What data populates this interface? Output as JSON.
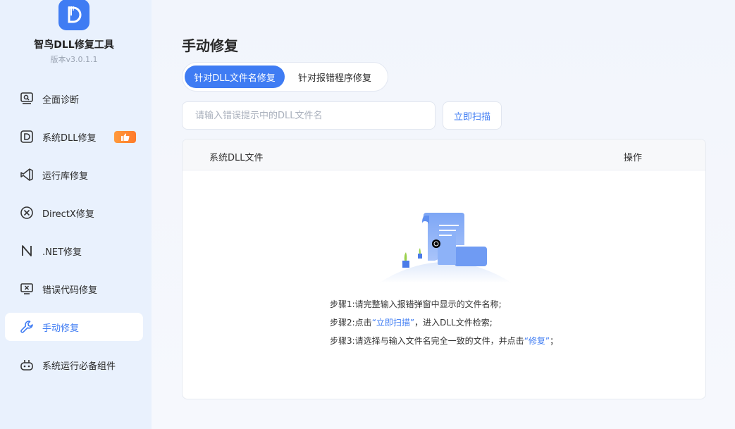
{
  "app": {
    "name": "智鸟DLL修复工具",
    "version": "版本v3.0.1.1"
  },
  "sidebar": {
    "items": [
      {
        "label": "全面诊断",
        "icon": "diagnose-icon"
      },
      {
        "label": "系统DLL修复",
        "icon": "dll-icon",
        "badge": "thumbs-up-icon"
      },
      {
        "label": "运行库修复",
        "icon": "runtime-icon"
      },
      {
        "label": "DirectX修复",
        "icon": "directx-icon"
      },
      {
        "label": ".NET修复",
        "icon": "dotnet-icon"
      },
      {
        "label": "错误代码修复",
        "icon": "error-code-icon"
      },
      {
        "label": "手动修复",
        "icon": "wrench-icon",
        "active": true
      },
      {
        "label": "系统运行必备组件",
        "icon": "components-icon"
      }
    ]
  },
  "main": {
    "title": "手动修复",
    "tabs": [
      {
        "label": "针对DLL文件名修复",
        "active": true
      },
      {
        "label": "针对报错程序修复",
        "active": false
      }
    ],
    "search": {
      "placeholder": "请输入错误提示中的DLL文件名",
      "value": ""
    },
    "scan_button": "立即扫描",
    "table": {
      "col_file": "系统DLL文件",
      "col_action": "操作"
    },
    "steps": {
      "s1": "步骤1:请完整输入报错弹窗中显示的文件名称;",
      "s2_prefix": "步骤2:点击",
      "s2_link": "“立即扫描”",
      "s2_suffix": "，进入DLL文件检索;",
      "s3_prefix": "步骤3:请选择与输入文件名完全一致的文件，并点击",
      "s3_link": "“修复”",
      "s3_suffix": "；"
    }
  },
  "colors": {
    "accent": "#3f7cf3",
    "sidebar_bg": "#e9f1fd",
    "badge": "#ff8a30"
  }
}
